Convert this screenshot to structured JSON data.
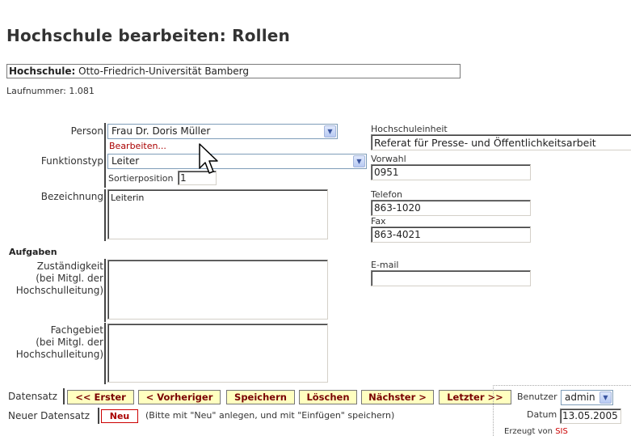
{
  "page": {
    "title": "Hochschule bearbeiten: Rollen"
  },
  "hochschule": {
    "label": "Hochschule:",
    "value": "Otto-Friedrich-Universität Bamberg"
  },
  "laufnummer": "Laufnummer: 1.081",
  "person": {
    "label": "Person",
    "value": "Frau Dr. Doris Müller",
    "edit_link": "Bearbeiten..."
  },
  "funktionstyp": {
    "label": "Funktionstyp",
    "value": "Leiter"
  },
  "sortierposition": {
    "label": "Sortierposition",
    "value": "1"
  },
  "bezeichnung": {
    "label": "Bezeichnung",
    "value": "Leiterin"
  },
  "aufgaben": {
    "heading": "Aufgaben"
  },
  "zustaendigkeit": {
    "label_line1": "Zuständigkeit",
    "label_line2": "(bei Mitgl. der",
    "label_line3": "Hochschulleitung)",
    "value": ""
  },
  "fachgebiet": {
    "label_line1": "Fachgebiet",
    "label_line2": "(bei Mitgl. der",
    "label_line3": "Hochschulleitung)",
    "value": ""
  },
  "hochschuleinheit": {
    "label": "Hochschuleinheit",
    "value": "Referat für Presse- und Öffentlichkeitsarbeit"
  },
  "vorwahl": {
    "label": "Vorwahl",
    "value": "0951"
  },
  "telefon": {
    "label": "Telefon",
    "value": "863-1020"
  },
  "fax": {
    "label": "Fax",
    "value": "863-4021"
  },
  "email": {
    "label": "E-mail",
    "value": ""
  },
  "datensatz": {
    "label": "Datensatz",
    "buttons": {
      "first": "<< Erster",
      "prev": "< Vorheriger",
      "save": "Speichern",
      "delete": "Löschen",
      "next": "Nächster >",
      "last": "Letzter >>"
    }
  },
  "neuer_datensatz": {
    "label": "Neuer Datensatz",
    "button": "Neu",
    "hint": "(Bitte mit \"Neu\" anlegen, und mit \"Einfügen\" speichern)"
  },
  "footer": {
    "benutzer_label": "Benutzer",
    "benutzer_value": "admin",
    "datum_label": "Datum",
    "datum_value": "13.05.2005",
    "erzeugt_label": "Erzeugt von",
    "erzeugt_brand": "SIS"
  },
  "colors": {
    "link": "#aa0000",
    "button_bg": "#ffffc0",
    "button_text": "#7a0000"
  }
}
